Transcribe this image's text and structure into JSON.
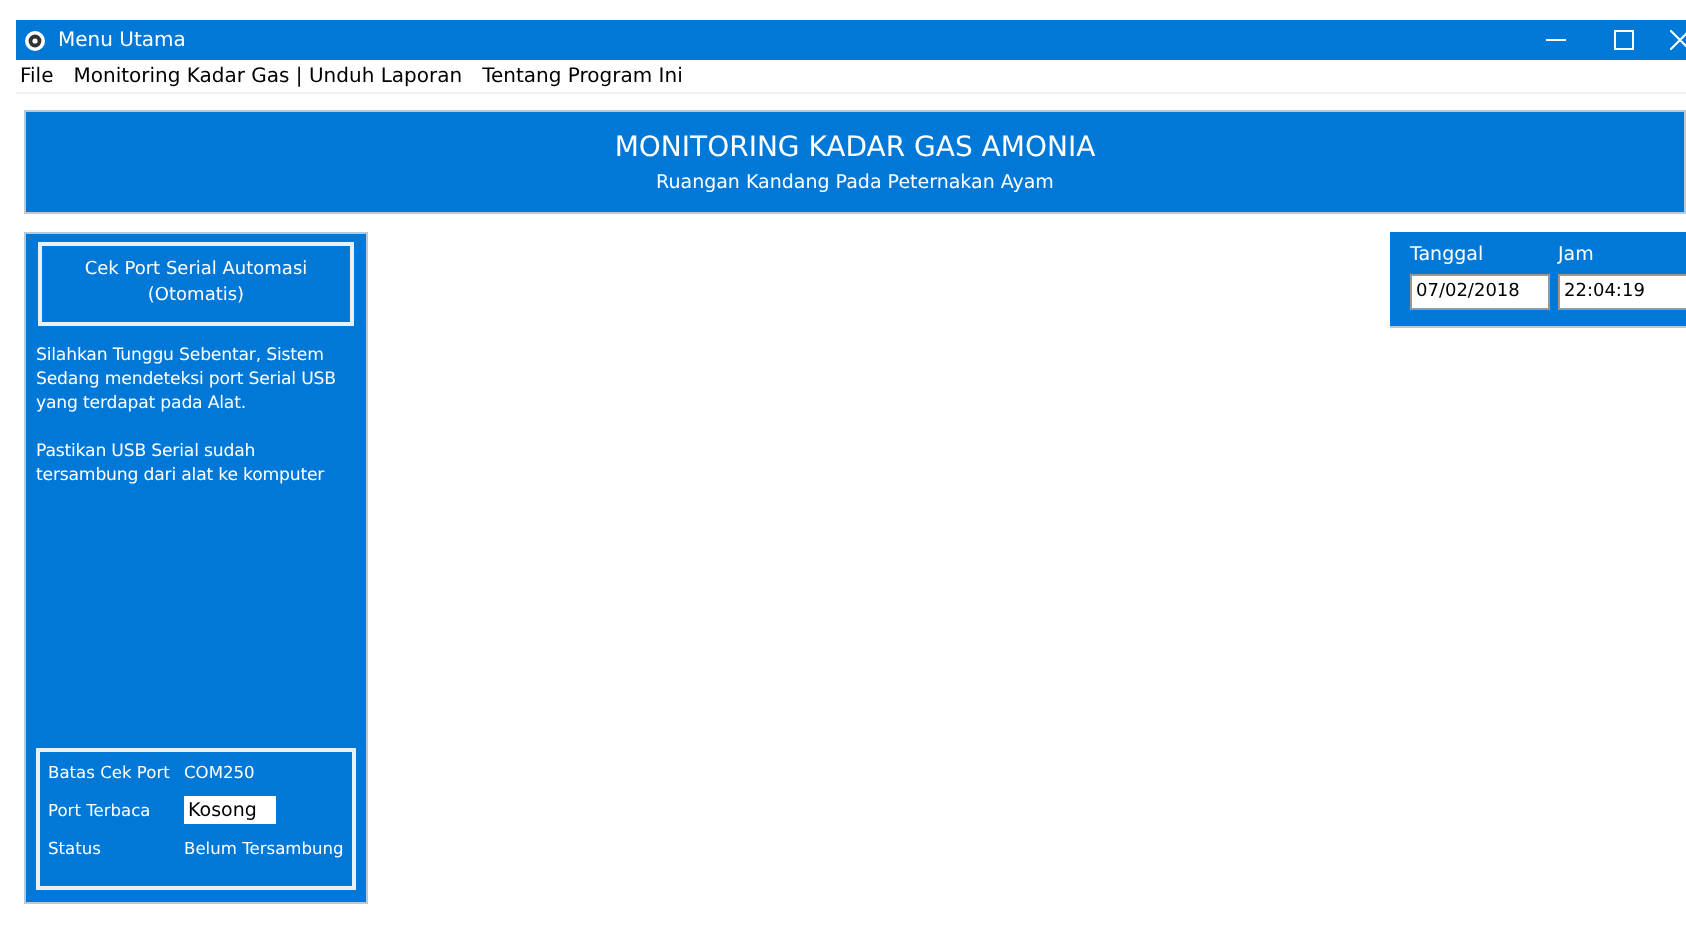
{
  "window": {
    "title": "Menu Utama"
  },
  "menu": [
    "File",
    "Monitoring Kadar Gas | Unduh Laporan",
    "Tentang Program Ini"
  ],
  "header": {
    "title": "MONITORING KADAR GAS AMONIA",
    "subtitle": "Ruangan Kandang Pada Peternakan Ayam"
  },
  "side_panel": {
    "button": "Cek Port Serial Automasi (Otomatis)",
    "messages": [
      "Silahkan Tunggu Sebentar, Sistem Sedang mendeteksi port Serial USB yang terdapat pada Alat.",
      "Pastikan USB Serial sudah tersambung dari alat ke komputer"
    ],
    "info": [
      {
        "label": "Batas Cek Port",
        "kind": "text",
        "value": "COM250"
      },
      {
        "label": "Port Terbaca",
        "kind": "field",
        "value": "Kosong"
      },
      {
        "label": "Status",
        "kind": "text",
        "value": "Belum Tersambung"
      }
    ]
  },
  "datetime": {
    "date_label": "Tanggal",
    "date": "07/02/2018",
    "time_label": "Jam",
    "time": "22:04:19"
  }
}
